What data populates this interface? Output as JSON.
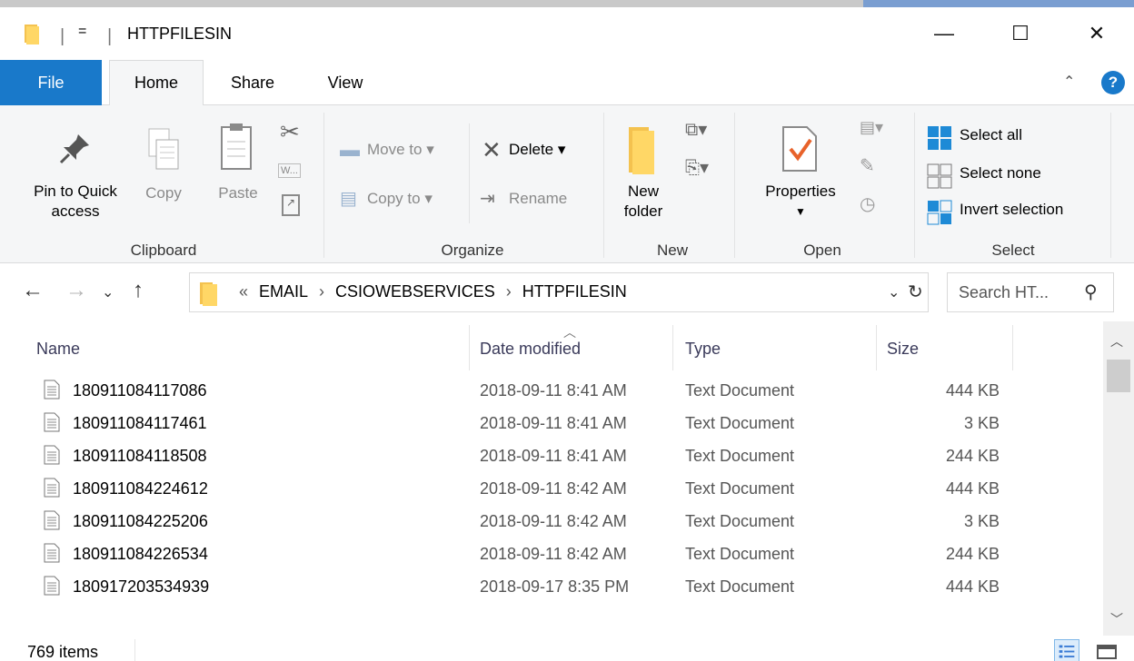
{
  "window": {
    "title": "HTTPFILESIN",
    "qa_dropdown": "=",
    "minimize": "—",
    "maximize": "☐",
    "close": "✕"
  },
  "tabs": {
    "file": "File",
    "home": "Home",
    "share": "Share",
    "view": "View",
    "help": "?"
  },
  "ribbon": {
    "clipboard": {
      "label": "Clipboard",
      "pin_line1": "Pin to Quick",
      "pin_line2": "access",
      "copy": "Copy",
      "paste": "Paste"
    },
    "organize": {
      "label": "Organize",
      "move_to": "Move to",
      "copy_to": "Copy to",
      "delete": "Delete",
      "rename": "Rename"
    },
    "new": {
      "label": "New",
      "new_folder_line1": "New",
      "new_folder_line2": "folder"
    },
    "open": {
      "label": "Open",
      "properties": "Properties"
    },
    "select": {
      "label": "Select",
      "select_all": "Select all",
      "select_none": "Select none",
      "invert": "Invert selection"
    }
  },
  "address": {
    "overflow": "«",
    "crumbs": [
      "EMAIL",
      "CSIOWEBSERVICES",
      "HTTPFILESIN"
    ],
    "search_placeholder": "Search HT..."
  },
  "columns": {
    "name": "Name",
    "date": "Date modified",
    "type": "Type",
    "size": "Size"
  },
  "files": [
    {
      "name": "180911084117086",
      "date": "2018-09-11 8:41 AM",
      "type": "Text Document",
      "size": "444 KB"
    },
    {
      "name": "180911084117461",
      "date": "2018-09-11 8:41 AM",
      "type": "Text Document",
      "size": "3 KB"
    },
    {
      "name": "180911084118508",
      "date": "2018-09-11 8:41 AM",
      "type": "Text Document",
      "size": "244 KB"
    },
    {
      "name": "180911084224612",
      "date": "2018-09-11 8:42 AM",
      "type": "Text Document",
      "size": "444 KB"
    },
    {
      "name": "180911084225206",
      "date": "2018-09-11 8:42 AM",
      "type": "Text Document",
      "size": "3 KB"
    },
    {
      "name": "180911084226534",
      "date": "2018-09-11 8:42 AM",
      "type": "Text Document",
      "size": "244 KB"
    },
    {
      "name": "180917203534939",
      "date": "2018-09-17 8:35 PM",
      "type": "Text Document",
      "size": "444 KB"
    }
  ],
  "status": {
    "item_count": "769 items"
  },
  "colors": {
    "accent": "#1979ca",
    "ribbon_bg": "#f5f6f7",
    "folder": "#ffd766"
  }
}
